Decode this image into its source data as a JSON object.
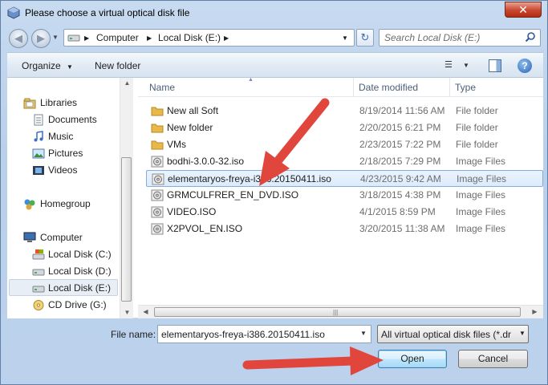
{
  "window": {
    "title": "Please choose a virtual optical disk file",
    "close_label": "✕"
  },
  "address": {
    "segments": [
      "Computer",
      "Local Disk (E:)"
    ],
    "search_placeholder": "Search Local Disk (E:)"
  },
  "toolbar": {
    "organize_label": "Organize",
    "new_folder_label": "New folder"
  },
  "nav": {
    "items": [
      {
        "label": "Libraries",
        "icon": "libraries-icon"
      },
      {
        "label": "Documents",
        "icon": "documents-icon"
      },
      {
        "label": "Music",
        "icon": "music-icon"
      },
      {
        "label": "Pictures",
        "icon": "pictures-icon"
      },
      {
        "label": "Videos",
        "icon": "videos-icon"
      },
      {
        "label": "Homegroup",
        "icon": "homegroup-icon"
      },
      {
        "label": "Computer",
        "icon": "computer-icon"
      },
      {
        "label": "Local Disk (C:)",
        "icon": "drive-icon"
      },
      {
        "label": "Local Disk (D:)",
        "icon": "drive-icon"
      },
      {
        "label": "Local Disk (E:)",
        "icon": "drive-icon"
      },
      {
        "label": "CD Drive (G:)",
        "icon": "cd-drive-icon"
      }
    ],
    "selected": "Local Disk (E:)"
  },
  "columns": {
    "name": "Name",
    "date": "Date modified",
    "type": "Type"
  },
  "files": [
    {
      "name": "New all Soft",
      "date": "8/19/2014 11:56 AM",
      "type": "File folder",
      "icon": "folder-icon"
    },
    {
      "name": "New folder",
      "date": "2/20/2015 6:21 PM",
      "type": "File folder",
      "icon": "folder-icon"
    },
    {
      "name": "VMs",
      "date": "2/23/2015 7:22 PM",
      "type": "File folder",
      "icon": "folder-icon"
    },
    {
      "name": "bodhi-3.0.0-32.iso",
      "date": "2/18/2015 7:29 PM",
      "type": "Image Files",
      "icon": "disc-image-icon"
    },
    {
      "name": "elementaryos-freya-i386.20150411.iso",
      "date": "4/23/2015 9:42 AM",
      "type": "Image Files",
      "icon": "disc-image-icon",
      "selected": true
    },
    {
      "name": "GRMCULFRER_EN_DVD.ISO",
      "date": "3/18/2015 4:38 PM",
      "type": "Image Files",
      "icon": "disc-image-icon"
    },
    {
      "name": "VIDEO.ISO",
      "date": "4/1/2015 8:59 PM",
      "type": "Image Files",
      "icon": "disc-image-icon"
    },
    {
      "name": "X2PVOL_EN.ISO",
      "date": "3/20/2015 11:38 AM",
      "type": "Image Files",
      "icon": "disc-image-icon"
    }
  ],
  "footer": {
    "file_name_label": "File name:",
    "file_name_value": "elementaryos-freya-i386.20150411.iso",
    "file_type_value": "All virtual optical disk files (*.dr",
    "open_label": "Open",
    "cancel_label": "Cancel"
  },
  "colors": {
    "annotation_arrow": "#e0463b",
    "selection_border": "#84acdd",
    "folder": "#e8b84a"
  }
}
